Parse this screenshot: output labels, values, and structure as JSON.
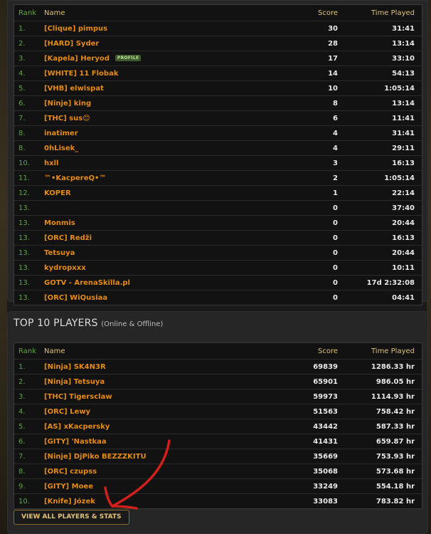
{
  "server_table": {
    "headers": {
      "rank": "Rank",
      "name": "Name",
      "score": "Score",
      "time": "Time Played"
    },
    "rows": [
      {
        "rank": "1.",
        "name": "[Clique] pimpus",
        "score": "30",
        "time": "31:41"
      },
      {
        "rank": "2.",
        "name": "[HARD] Syder",
        "score": "28",
        "time": "13:14"
      },
      {
        "rank": "3.",
        "name": "[Kapela] Heryod",
        "badge": "PROFILE",
        "score": "17",
        "time": "33:10"
      },
      {
        "rank": "4.",
        "name": "[WHITE] 11 Flobak",
        "score": "14",
        "time": "54:13"
      },
      {
        "rank": "5.",
        "name": "[VHB] elwispat",
        "score": "10",
        "time": "1:05:14"
      },
      {
        "rank": "6.",
        "name": "[Ninje] king",
        "score": "8",
        "time": "13:14"
      },
      {
        "rank": "7.",
        "name": "[THC] sus😊",
        "score": "6",
        "time": "11:41"
      },
      {
        "rank": "8.",
        "name": "inatimer",
        "score": "4",
        "time": "31:41"
      },
      {
        "rank": "8.",
        "name": "0hLisek_",
        "score": "4",
        "time": "29:11"
      },
      {
        "rank": "10.",
        "name": "hxll",
        "score": "3",
        "time": "16:13"
      },
      {
        "rank": "11.",
        "name": "™•KacpereQ•™",
        "score": "2",
        "time": "1:05:14"
      },
      {
        "rank": "12.",
        "name": "KOPER",
        "score": "1",
        "time": "22:14"
      },
      {
        "rank": "13.",
        "name": "",
        "score": "0",
        "time": "37:40"
      },
      {
        "rank": "13.",
        "name": "Monmis",
        "score": "0",
        "time": "20:44"
      },
      {
        "rank": "13.",
        "name": "[ORC] Redži",
        "score": "0",
        "time": "16:13"
      },
      {
        "rank": "13.",
        "name": "Tetsuya",
        "score": "0",
        "time": "20:44"
      },
      {
        "rank": "13.",
        "name": "kydropxxx",
        "score": "0",
        "time": "10:11"
      },
      {
        "rank": "13.",
        "name": "GOTV - ArenaSkilla.pl",
        "score": "0",
        "time": "17d 2:32:08"
      },
      {
        "rank": "13.",
        "name": "[ORC] WiQusiaa",
        "score": "0",
        "time": "04:41"
      }
    ]
  },
  "top10": {
    "title": "TOP 10 PLAYERS",
    "subtitle": "(Online & Offline)",
    "headers": {
      "rank": "Rank",
      "name": "Name",
      "score": "Score",
      "time": "Time Played"
    },
    "rows": [
      {
        "rank": "1.",
        "name": "[Ninja] SK4N3R",
        "score": "69839",
        "time": "1286.33 hr"
      },
      {
        "rank": "2.",
        "name": "[Ninja] Tetsuya",
        "score": "65901",
        "time": "986.05 hr"
      },
      {
        "rank": "3.",
        "name": "[THC] Tigersclaw",
        "score": "59973",
        "time": "1114.93 hr"
      },
      {
        "rank": "4.",
        "name": "[ORC] Lewy",
        "score": "51563",
        "time": "758.42 hr"
      },
      {
        "rank": "5.",
        "name": "[AS] xKacpersky",
        "score": "43442",
        "time": "587.33 hr"
      },
      {
        "rank": "6.",
        "name": "[GITY] 'Nastkaa",
        "score": "41431",
        "time": "659.87 hr"
      },
      {
        "rank": "7.",
        "name": "[Ninje] DjPiko BEZZZKITU",
        "score": "35669",
        "time": "753.93 hr"
      },
      {
        "rank": "8.",
        "name": "[ORC] czupss",
        "score": "35068",
        "time": "573.68 hr"
      },
      {
        "rank": "9.",
        "name": "[GITY] Moee",
        "score": "33249",
        "time": "554.18 hr"
      },
      {
        "rank": "10.",
        "name": "[Knife] Józek",
        "score": "33083",
        "time": "783.82 hr"
      }
    ],
    "view_all_label": "VIEW ALL PLAYERS & STATS"
  },
  "colors": {
    "rank_green": "#5ea53f",
    "name_orange": "#e58b14",
    "header_gold": "#e0c27a",
    "arrow_red": "#d0201c"
  },
  "icons": {
    "annotation": "red-arrow-icon"
  }
}
